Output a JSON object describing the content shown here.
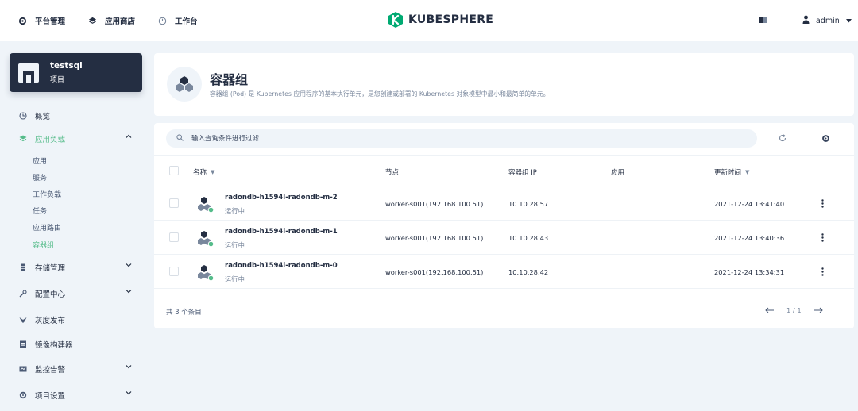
{
  "topnav": {
    "platform": "平台管理",
    "appstore": "应用商店",
    "workbench": "工作台"
  },
  "logo": {
    "text": "KUBESPHERE"
  },
  "user": {
    "name": "admin"
  },
  "project": {
    "name": "testsql",
    "type": "项目"
  },
  "menu": {
    "overview": "概览",
    "workloads": "应用负载",
    "workload_items": [
      "应用",
      "服务",
      "工作负载",
      "任务",
      "应用路由",
      "容器组"
    ],
    "storage": "存储管理",
    "config": "配置中心",
    "grayscale": "灰度发布",
    "image_builder": "镜像构建器",
    "monitoring": "监控告警",
    "settings": "项目设置"
  },
  "header": {
    "title": "容器组",
    "description": "容器组 (Pod) 是 Kubernetes 应用程序的基本执行单元，是您创建或部署的 Kubernetes 对象模型中最小和最简单的单元。"
  },
  "search": {
    "placeholder": "输入查询条件进行过滤"
  },
  "table": {
    "columns": {
      "name": "名称",
      "node": "节点",
      "pod_ip": "容器组 IP",
      "app": "应用",
      "updated": "更新时间"
    },
    "rows": [
      {
        "name": "radondb-h1594l-radondb-m-2",
        "status": "运行中",
        "node": "worker-s001(192.168.100.51)",
        "ip": "10.10.28.57",
        "app": "",
        "updated": "2021-12-24 13:41:40"
      },
      {
        "name": "radondb-h1594l-radondb-m-1",
        "status": "运行中",
        "node": "worker-s001(192.168.100.51)",
        "ip": "10.10.28.43",
        "app": "",
        "updated": "2021-12-24 13:40:36"
      },
      {
        "name": "radondb-h1594l-radondb-m-0",
        "status": "运行中",
        "node": "worker-s001(192.168.100.51)",
        "ip": "10.10.28.42",
        "app": "",
        "updated": "2021-12-24 13:34:31"
      }
    ]
  },
  "footer": {
    "total": "共 3 个条目",
    "page": "1 / 1"
  },
  "colors": {
    "accent": "#55bc8a",
    "dark": "#242e42",
    "bg": "#eff4f9"
  }
}
